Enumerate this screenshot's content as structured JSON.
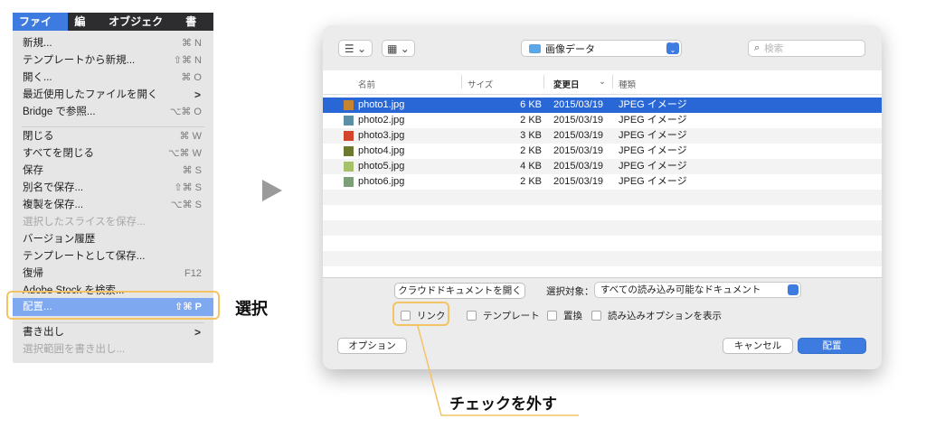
{
  "menubar": {
    "items": [
      "ファイル",
      "編集",
      "オブジェクト",
      "書式"
    ]
  },
  "menu": {
    "items": [
      {
        "label": "新規...",
        "shortcut": "⌘ N"
      },
      {
        "label": "テンプレートから新規...",
        "shortcut": "⇧⌘ N"
      },
      {
        "label": "開く...",
        "shortcut": "⌘ O"
      },
      {
        "label": "最近使用したファイルを開く",
        "shortcut": ">"
      },
      {
        "label": "Bridge で参照...",
        "shortcut": "⌥⌘ O"
      },
      {
        "label": "閉じる",
        "shortcut": "⌘ W"
      },
      {
        "label": "すべてを閉じる",
        "shortcut": "⌥⌘ W"
      },
      {
        "label": "保存",
        "shortcut": "⌘ S"
      },
      {
        "label": "別名で保存...",
        "shortcut": "⇧⌘ S"
      },
      {
        "label": "複製を保存...",
        "shortcut": "⌥⌘ S"
      },
      {
        "label": "選択したスライスを保存...",
        "shortcut": ""
      },
      {
        "label": "バージョン履歴",
        "shortcut": ""
      },
      {
        "label": "テンプレートとして保存...",
        "shortcut": ""
      },
      {
        "label": "復帰",
        "shortcut": "F12"
      },
      {
        "label": "Adobe Stock を検索...",
        "shortcut": ""
      },
      {
        "label": "配置...",
        "shortcut": "⇧⌘ P"
      },
      {
        "label": "書き出し",
        "shortcut": ">"
      },
      {
        "label": "選択範囲を書き出し...",
        "shortcut": ""
      }
    ]
  },
  "annotations": {
    "select": "選択",
    "uncheck": "チェックを外す"
  },
  "dialog": {
    "toolbar": {
      "list_view": "☰ ⌄",
      "grid_view": "▦ ⌄",
      "folder": "画像データ",
      "search_placeholder": "検索"
    },
    "columns": {
      "name": "名前",
      "size": "サイズ",
      "date": "変更日",
      "kind": "種類"
    },
    "files": [
      {
        "name": "photo1.jpg",
        "size": "6 KB",
        "date": "2015/03/19",
        "kind": "JPEG イメージ",
        "thumb": "#c9842f"
      },
      {
        "name": "photo2.jpg",
        "size": "2 KB",
        "date": "2015/03/19",
        "kind": "JPEG イメージ",
        "thumb": "#5b8fa6"
      },
      {
        "name": "photo3.jpg",
        "size": "3 KB",
        "date": "2015/03/19",
        "kind": "JPEG イメージ",
        "thumb": "#d2452a"
      },
      {
        "name": "photo4.jpg",
        "size": "2 KB",
        "date": "2015/03/19",
        "kind": "JPEG イメージ",
        "thumb": "#6b7a2f"
      },
      {
        "name": "photo5.jpg",
        "size": "4 KB",
        "date": "2015/03/19",
        "kind": "JPEG イメージ",
        "thumb": "#a7c06a"
      },
      {
        "name": "photo6.jpg",
        "size": "2 KB",
        "date": "2015/03/19",
        "kind": "JPEG イメージ",
        "thumb": "#7c9e78"
      }
    ],
    "cloud_button": "クラウドドキュメントを開く",
    "format_label": "選択対象：",
    "format_value": "すべての読み込み可能なドキュメント",
    "options": {
      "link": "リンク",
      "template": "テンプレート",
      "replace": "置換",
      "show_import": "読み込みオプションを表示"
    },
    "buttons": {
      "options": "オプション",
      "cancel": "キャンセル",
      "place": "配置"
    }
  }
}
